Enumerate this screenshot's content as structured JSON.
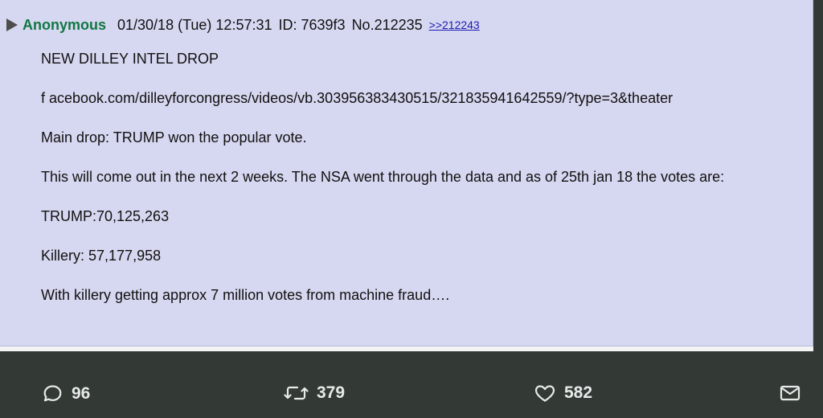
{
  "post": {
    "poster_name": "Anonymous",
    "date": "01/30/18 (Tue) 12:57:31",
    "id": "ID: 7639f3",
    "number": "No.212235",
    "reply_link": ">>212243",
    "body": [
      "NEW DILLEY INTEL DROP",
      "f acebook.com/dilleyforcongress/videos/vb.303956383430515/321835941642559/?type=3&theater",
      "Main drop: TRUMP won the popular vote.",
      "This will come out in the next 2 weeks. The NSA went through the data and as of 25th jan 18 the votes are:",
      "TRUMP:70,125,263",
      "Killery: 57,177,958",
      "With killery getting approx 7 million votes from machine fraud…."
    ]
  },
  "tweet_actions": {
    "replies": "96",
    "retweets": "379",
    "likes": "582",
    "icons": {
      "reply": "reply-bubble-icon",
      "retweet": "retweet-icon",
      "like": "heart-icon",
      "share": "envelope-icon"
    }
  },
  "colors": {
    "post_background": "#d6d7f0",
    "poster_name": "#117743",
    "page_background": "#333a35",
    "action_text": "#e7e9ea"
  }
}
